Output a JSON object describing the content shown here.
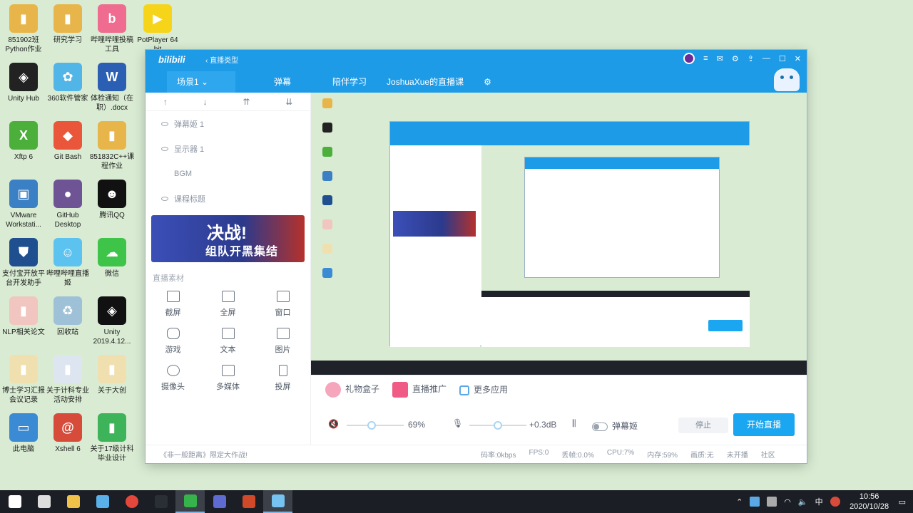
{
  "desktop": {
    "icons": [
      {
        "label": "851902班Python作业",
        "color": "#e8b54a",
        "glyph": "▮"
      },
      {
        "label": "研究学习",
        "color": "#e8b54a",
        "glyph": "▮"
      },
      {
        "label": "哔哩哔哩投稿工具",
        "color": "#ef6b8f",
        "glyph": "b"
      },
      {
        "label": "PotPlayer 64 bit",
        "color": "#f6d419",
        "glyph": "▶"
      },
      {
        "label": "Unity Hub",
        "color": "#222222",
        "glyph": "◈"
      },
      {
        "label": "360软件管家",
        "color": "#52b5e8",
        "glyph": "✿"
      },
      {
        "label": "体检通知（在职）.docx",
        "color": "#2b5fb4",
        "glyph": "W"
      },
      {
        "label": "Xftp 6",
        "color": "#4cae3b",
        "glyph": "X"
      },
      {
        "label": "Git Bash",
        "color": "#e9563a",
        "glyph": "◆"
      },
      {
        "label": "851832C++课程作业",
        "color": "#e8b54a",
        "glyph": "▮"
      },
      {
        "label": "VMware Workstati...",
        "color": "#3b7fc4",
        "glyph": "▣"
      },
      {
        "label": "GitHub Desktop",
        "color": "#6e5494",
        "glyph": "●"
      },
      {
        "label": "腾讯QQ",
        "color": "#111111",
        "glyph": "☻"
      },
      {
        "label": "支付宝开放平台开发助手",
        "color": "#1f4f8f",
        "glyph": "⛊"
      },
      {
        "label": "哔哩哔哩直播姬",
        "color": "#5cc3f0",
        "glyph": "☺"
      },
      {
        "label": "微信",
        "color": "#3ec449",
        "glyph": "☁"
      },
      {
        "label": "NLP相关论文",
        "color": "#f1c6c0",
        "glyph": "▮"
      },
      {
        "label": "回收站",
        "color": "#9fc1d8",
        "glyph": "♻"
      },
      {
        "label": "Unity 2019.4.12...",
        "color": "#111111",
        "glyph": "◈"
      },
      {
        "label": "博士学习汇报会议记录",
        "color": "#f0e0b0",
        "glyph": "▮"
      },
      {
        "label": "关于计科专业活动安排",
        "color": "#dde6f0",
        "glyph": "▮"
      },
      {
        "label": "关于大创",
        "color": "#f0e0b0",
        "glyph": "▮"
      },
      {
        "label": "此电脑",
        "color": "#3a8ad4",
        "glyph": "▭"
      },
      {
        "label": "Xshell 6",
        "color": "#d64b3a",
        "glyph": "@"
      },
      {
        "label": "关于17级计科毕业设计",
        "color": "#3db35a",
        "glyph": "▮"
      }
    ]
  },
  "window": {
    "logo": "bilibili",
    "type_label": "‹ 直播类型",
    "tabs": [
      {
        "label": "场景1 ⌄",
        "active": true
      },
      {
        "label": "弹幕",
        "active": false
      },
      {
        "label": "陪伴学习",
        "active": false
      },
      {
        "label": "JoshuaXue的直播课",
        "active": false
      },
      {
        "label": "⚙",
        "active": false
      }
    ],
    "controls": [
      "≡",
      "✉",
      "⚙",
      "⇪",
      "—",
      "☐",
      "✕"
    ]
  },
  "left_panel": {
    "arrows": [
      "↑",
      "↓",
      "⇈",
      "⇊"
    ],
    "sources": [
      "弹幕姬 1",
      "显示器 1",
      "BGM",
      "课程标题"
    ],
    "banner": {
      "line1": "决战!",
      "line2": "组队开黑集结"
    },
    "section_title": "直播素材",
    "tools": [
      "截屏",
      "全屏",
      "窗口",
      "游戏",
      "文本",
      "图片",
      "摄像头",
      "多媒体",
      "投屏"
    ]
  },
  "action_bar": {
    "gift": "礼物盒子",
    "promo": "直播推广",
    "apps": "更多应用"
  },
  "control_bar": {
    "volume_percent": "69%",
    "volume_value": 0.69,
    "mic_db": "+0.3dB",
    "mic_value": 0.3,
    "danmaku_label": "弹幕姬",
    "stop_label": "停止",
    "start_label": "开始直播"
  },
  "status_bar": {
    "notice": "《非一般距离》限定大作战!",
    "bitrate": "码率:0kbps",
    "fps": "FPS:0",
    "drop": "丢帧:0.0%",
    "cpu": "CPU:7%",
    "memory": "内存:59%",
    "quality": "画质:无",
    "live_status": "未开播",
    "help": "社区"
  },
  "taskbar": {
    "apps": [
      {
        "name": "windows-start",
        "color": "#ffffff"
      },
      {
        "name": "search",
        "color": "#dddddd"
      },
      {
        "name": "file-explorer",
        "color": "#f0c24a"
      },
      {
        "name": "cloud-app",
        "color": "#5ab0e8"
      },
      {
        "name": "chrome",
        "color": "#e4473b"
      },
      {
        "name": "terminal",
        "color": "#2a2e35"
      },
      {
        "name": "pycharm",
        "color": "#36b34a"
      },
      {
        "name": "vs-code",
        "color": "#5e6bd0"
      },
      {
        "name": "powerpoint",
        "color": "#d04a2a"
      },
      {
        "name": "bilibili-live",
        "color": "#76c2f0"
      }
    ],
    "time": "10:56",
    "date": "2020/10/28",
    "ime": "中"
  }
}
